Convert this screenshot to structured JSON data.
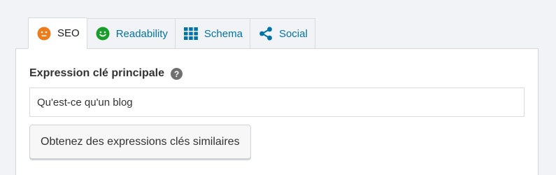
{
  "tabs": [
    {
      "label": "SEO",
      "icon": "sad-face-icon",
      "icon_color": "#ee7c1b",
      "active": true
    },
    {
      "label": "Readability",
      "icon": "smiley-face-icon",
      "icon_color": "#1a9e2b",
      "active": false
    },
    {
      "label": "Schema",
      "icon": "grid-icon",
      "icon_color": "#0073aa",
      "active": false
    },
    {
      "label": "Social",
      "icon": "share-icon",
      "icon_color": "#0073aa",
      "active": false
    }
  ],
  "focus_keyphrase": {
    "label": "Expression clé principale",
    "value": "Qu'est-ce qu'un blog"
  },
  "related_button": {
    "label": "Obtenez des expressions clés similaires"
  },
  "colors": {
    "link": "#0073aa",
    "seo_status": "#ee7c1b",
    "readability_status": "#1a9e2b"
  }
}
